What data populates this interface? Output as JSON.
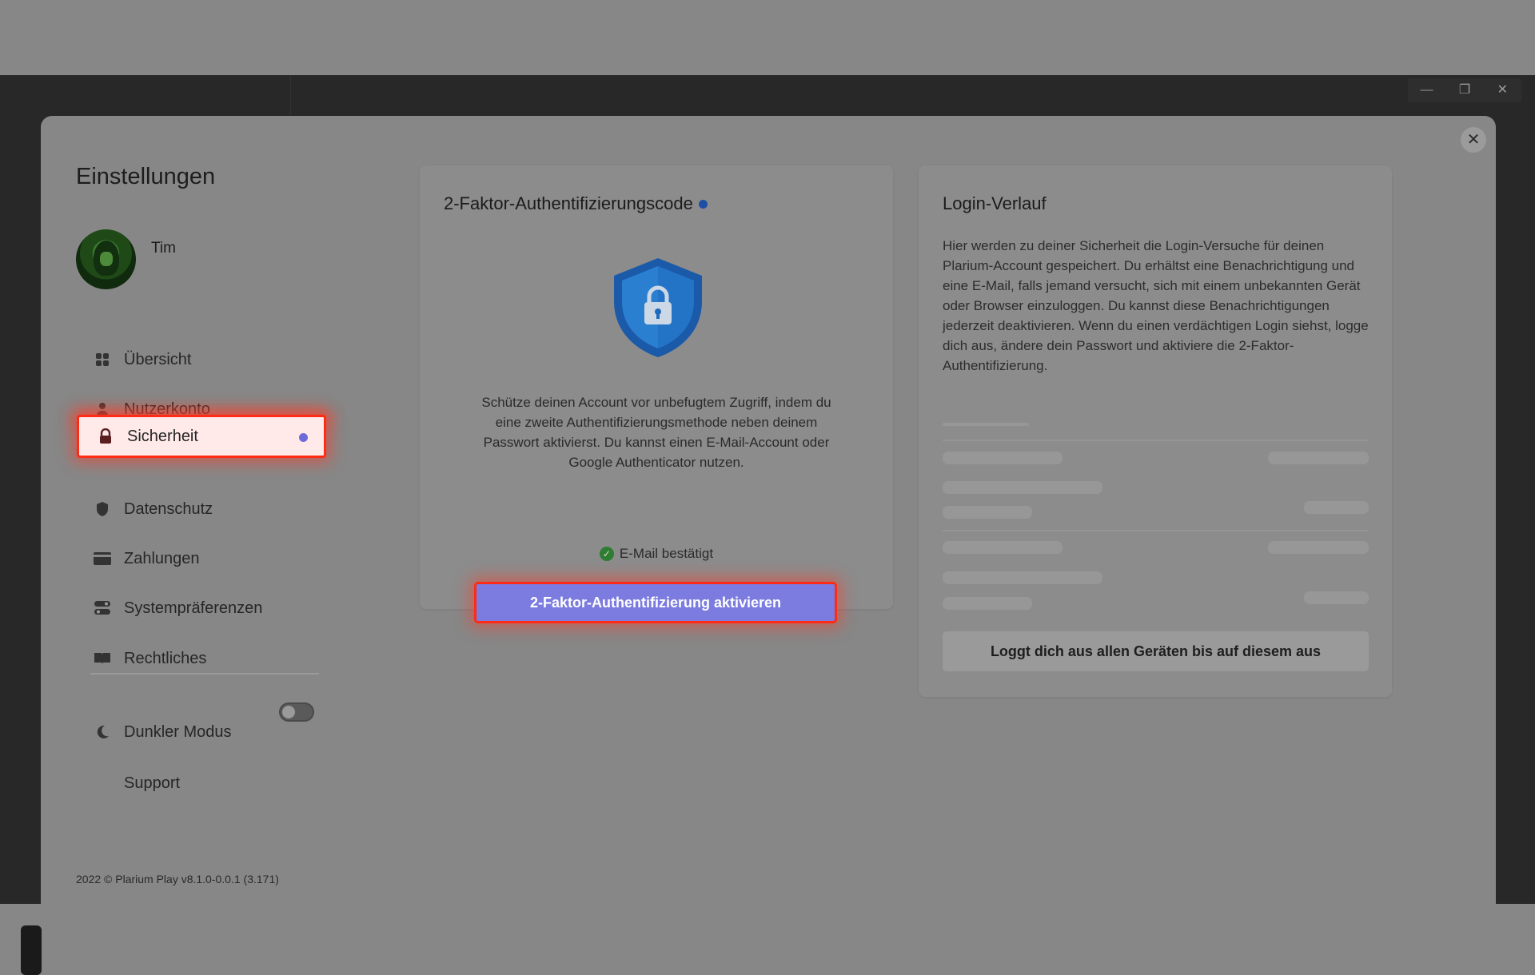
{
  "window": {
    "minimize_icon": "minimize-icon",
    "maximize_icon": "restore-icon",
    "close_icon": "close-icon"
  },
  "modal": {
    "close_icon": "close-icon"
  },
  "sidebar": {
    "title": "Einstellungen",
    "user": {
      "name": "Tim"
    },
    "items": [
      {
        "label": "Übersicht",
        "icon": "grid-icon"
      },
      {
        "label": "Nutzerkonto",
        "icon": "user-icon"
      },
      {
        "label": "Sicherheit",
        "icon": "lock-icon",
        "active": true
      },
      {
        "label": "Datenschutz",
        "icon": "shield-icon"
      },
      {
        "label": "Zahlungen",
        "icon": "credit-card-icon"
      },
      {
        "label": "Systempräferenzen",
        "icon": "toggles-icon"
      },
      {
        "label": "Rechtliches",
        "icon": "book-icon"
      }
    ],
    "dark_mode": {
      "label": "Dunkler Modus",
      "icon": "moon-icon",
      "enabled": false
    },
    "support": {
      "label": "Support"
    },
    "footer": "2022 © Plarium Play v8.1.0-0.0.1 (3.171)"
  },
  "twofa": {
    "title": "2-Faktor-Authentifizierungscode",
    "description": "Schütze deinen Account vor unbefugtem Zugriff, indem du eine zweite Authentifizierungsmethode neben deinem Passwort aktivierst. Du kannst einen E-Mail-Account oder Google Authenticator nutzen.",
    "verified_label": "E-Mail bestätigt",
    "button_label": "2-Faktor-Authentifizierung aktivieren",
    "shield_color": "#1d63b8"
  },
  "login_history": {
    "title": "Login-Verlauf",
    "description": "Hier werden zu deiner Sicherheit die Login-Versuche für deinen Plarium-Account gespeichert. Du erhältst eine Benachrichtigung und eine E-Mail, falls jemand versucht, sich mit einem unbekannten Gerät oder Browser einzuloggen. Du kannst diese Benachrichtigungen jederzeit deaktivieren. Wenn du einen verdächtigen Login siehst, logge dich aus, ändere dein Passwort und aktiviere die 2-Faktor-Authentifizierung.",
    "logout_button": "Loggt dich aus allen Geräten bis auf diesem aus"
  },
  "colors": {
    "highlight_border": "#ff2b14",
    "button_accent": "#7b7be0",
    "active_dot": "#6d6bd8"
  }
}
